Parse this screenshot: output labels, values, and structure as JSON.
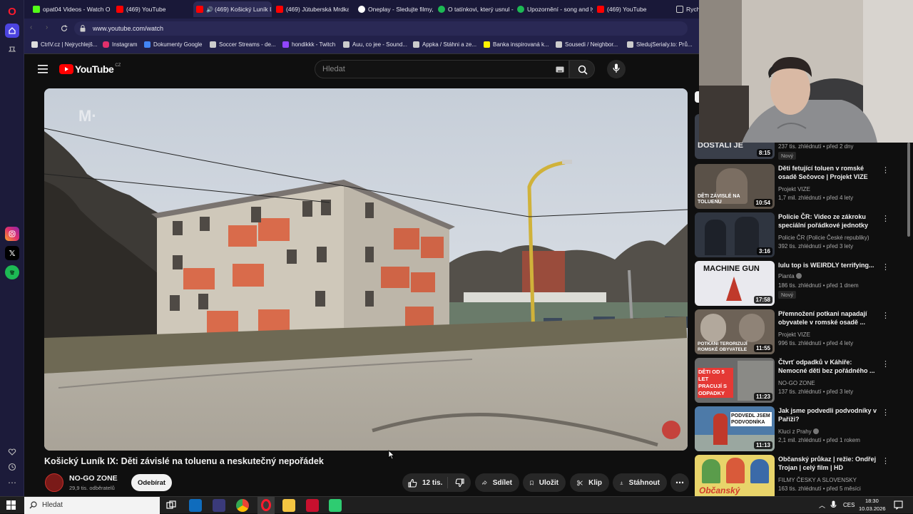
{
  "browser": {
    "tabs": [
      {
        "label": "opat04 Videos - Watch O",
        "color": "#53fc18"
      },
      {
        "label": "(469) YouTube",
        "color": "#ff0000"
      },
      {
        "label": "(469) Košický Luník IX",
        "color": "#ff0000",
        "active": true
      },
      {
        "label": "(469) Jūtuberská Mrdka -",
        "color": "#ff0000"
      },
      {
        "label": "Oneplay - Sledujte filmy,",
        "color": "#ffffff"
      },
      {
        "label": "O tatínkovi, který usnul -",
        "color": "#1db954"
      },
      {
        "label": "Upozornění - song and ly",
        "color": "#1db954"
      },
      {
        "label": "(469) YouTube",
        "color": "#ff0000"
      },
      {
        "label": "Rych",
        "color": "#ffffff"
      }
    ],
    "url": "www.youtube.com/watch",
    "bookmarks": [
      {
        "label": "CtrlV.cz | Nejrychlejš...",
        "color": "#dddddd"
      },
      {
        "label": "Instagram",
        "color": "#e1306c"
      },
      {
        "label": "Dokumenty Google",
        "color": "#4285f4"
      },
      {
        "label": "Soccer Streams - de...",
        "color": "#cccccc"
      },
      {
        "label": "hondikkk - Twitch",
        "color": "#9146ff"
      },
      {
        "label": "Auu, co jee - Sound...",
        "color": "#cccccc"
      },
      {
        "label": "Appka / Stáhni a ze...",
        "color": "#cccccc"
      },
      {
        "label": "Banka inspirovaná k...",
        "color": "#fff200"
      },
      {
        "label": "Sousedi / Neighbor...",
        "color": "#cccccc"
      },
      {
        "label": "SledujSerialy.to: Prů...",
        "color": "#cccccc"
      }
    ]
  },
  "youtube": {
    "logo_text": "YouTube",
    "region": "CZ",
    "search_placeholder": "Hledat",
    "video": {
      "watermark": "M·",
      "title": "Košický Luník IX: Děti závislé na toluenu a neskutečný nepořádek",
      "channel": "NO-GO ZONE",
      "subscribers": "29,9 tis. odběratelů",
      "subscribe_label": "Odebírat",
      "likes": "12 tis.",
      "share_label": "Sdílet",
      "save_label": "Uložit",
      "clip_label": "Klip",
      "download_label": "Stáhnout"
    },
    "recommendations": [
      {
        "title": "",
        "thumb_text": "DOSTALI JE",
        "duration": "8:15",
        "channel": "",
        "meta": "237 tis. zhlédnutí • před 2 dny",
        "badge": "Nový",
        "bg": "#3a3f4a",
        "accent": "#c8c8c8"
      },
      {
        "title": "Děti fetující toluen v romské osadě Sečovce | Projekt VIZE",
        "thumb_text": "DĚTI ZÁVISLÉ NA TOLUENU",
        "duration": "10:54",
        "channel": "Projekt VIZE",
        "meta": "1,7 mil. zhlédnutí • před 4 lety",
        "badge": "",
        "bg": "#5a5148",
        "accent": "#ffffff"
      },
      {
        "title": "Policie ČR: Video ze zákroku speciální pořádkové jednotky",
        "thumb_text": "",
        "duration": "3:16",
        "channel": "Policie ČR (Policie České republiky)",
        "meta": "392 tis. zhlédnutí • před 3 lety",
        "badge": "",
        "bg": "#2f3540",
        "accent": "#ffffff"
      },
      {
        "title": "lulu top is WEIRDLY terrifying...",
        "thumb_text": "MACHINE GUN",
        "duration": "17:58",
        "channel": "Pianta",
        "meta": "186 tis. zhlédnutí • před 1 dnem",
        "badge": "Nový",
        "bg": "#e9e9ee",
        "accent": "#111111"
      },
      {
        "title": "Přemnožení potkani napadají obyvatele v romské osadě ...",
        "thumb_text": "POTKANI TERORIZUJÍ ROMSKÉ OBYVATELE",
        "duration": "11:55",
        "channel": "Projekt VIZE",
        "meta": "996 tis. zhlédnutí • před 4 lety",
        "badge": "",
        "bg": "#6d6257",
        "accent": "#ffffff"
      },
      {
        "title": "Čtvrť odpadků v Káhiře: Nemocné děti bez pořádného ...",
        "thumb_text": "DĚTI OD 5 LET PRACUJÍ S ODPADKY",
        "duration": "11:23",
        "channel": "NO-GO ZONE",
        "meta": "137 tis. zhlédnutí • před 3 lety",
        "badge": "",
        "bg": "#6a6a6a",
        "accent": "#e53935"
      },
      {
        "title": "Jak jsme podvedli podvodníky v Paříži?",
        "thumb_text": "PODVEDL JSEM PODVODNÍKA",
        "duration": "11:13",
        "channel": "Kluci z Prahy",
        "meta": "2,1 mil. zhlédnutí • před 1 rokem",
        "badge": "",
        "bg": "#4d7aa8",
        "accent": "#ffffff"
      },
      {
        "title": "Občanský průkaz | režie: Ondřej Trojan | celý film | HD",
        "thumb_text": "Občanský",
        "duration": "",
        "channel": "FILMY ČESKY A SLOVENSKY",
        "meta": "163 tis. zhlédnutí • před 5 měsíci",
        "badge": "",
        "bg": "#e8d46a",
        "accent": "#d23b2b"
      }
    ]
  },
  "taskbar": {
    "search_placeholder": "Hledat",
    "language": "CES",
    "time": "18:30",
    "date": "10.03.2026"
  }
}
